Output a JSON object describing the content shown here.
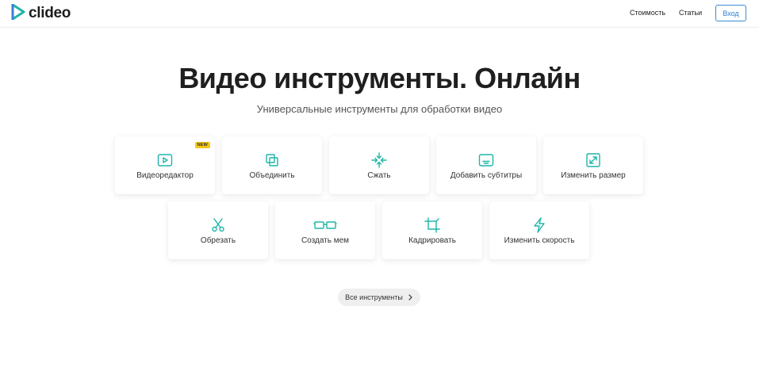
{
  "header": {
    "logo_text": "clideo",
    "nav": [
      "Стоимость",
      "Статьи"
    ],
    "login_label": "Вход"
  },
  "hero": {
    "title": "Видео инструменты. Онлайн",
    "subtitle": "Универсальные инструменты для обработки видео"
  },
  "tools": [
    {
      "label": "Видеоредактор",
      "icon": "play-icon",
      "badge": "NEW"
    },
    {
      "label": "Объединить",
      "icon": "merge-icon"
    },
    {
      "label": "Сжать",
      "icon": "compress-icon"
    },
    {
      "label": "Добавить субтитры",
      "icon": "subtitles-icon"
    },
    {
      "label": "Изменить размер",
      "icon": "resize-icon"
    },
    {
      "label": "Обрезать",
      "icon": "scissors-icon"
    },
    {
      "label": "Создать мем",
      "icon": "glasses-icon"
    },
    {
      "label": "Кадрировать",
      "icon": "crop-icon"
    },
    {
      "label": "Изменить скорость",
      "icon": "lightning-icon"
    }
  ],
  "all_tools_label": "Все инструменты",
  "colors": {
    "accent": "#1fb5a8",
    "login_border": "#3b8ad9",
    "badge": "#f5c518"
  }
}
